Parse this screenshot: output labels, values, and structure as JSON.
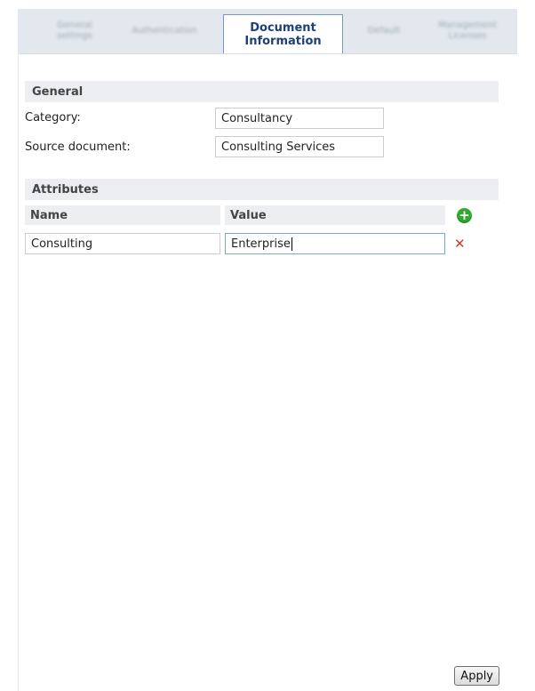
{
  "tabs": [
    {
      "label": "General settings",
      "active": false
    },
    {
      "label": "Authentication",
      "active": false
    },
    {
      "label": "Document Information",
      "active": true
    },
    {
      "label": "Default",
      "active": false
    },
    {
      "label": "Management Licenses",
      "active": false
    }
  ],
  "general": {
    "header": "General",
    "category_label": "Category:",
    "category_value": "Consultancy",
    "source_label": "Source document:",
    "source_value": "Consulting Services"
  },
  "attributes": {
    "header": "Attributes",
    "col_name": "Name",
    "col_value": "Value",
    "rows": [
      {
        "name": "Consulting",
        "value": "Enterprise"
      }
    ],
    "add_icon": "add-circle-icon",
    "remove_icon": "remove-x-icon"
  },
  "actions": {
    "apply_label": "Apply"
  },
  "colors": {
    "active_tab_text": "#1f3f78",
    "add_icon": "#2faa2f",
    "remove_icon": "#d43a2a",
    "section_bg": "#eceef1"
  }
}
